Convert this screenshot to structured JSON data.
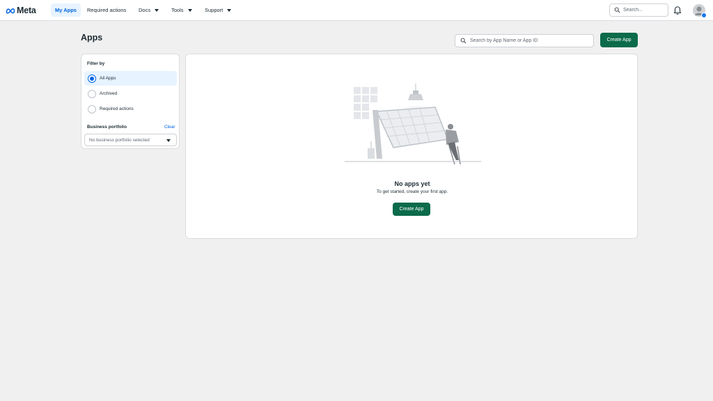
{
  "nav": {
    "brand": "Meta",
    "items": [
      {
        "label": "My Apps"
      },
      {
        "label": "Required actions"
      },
      {
        "label": "Docs"
      },
      {
        "label": "Tools"
      },
      {
        "label": "Support"
      }
    ],
    "search_placeholder": "Search..."
  },
  "header": {
    "title": "Apps",
    "search_placeholder": "Search by App Name or App ID",
    "create_label": "Create App"
  },
  "filter": {
    "title": "Filter by",
    "options": [
      {
        "label": "All Apps",
        "selected": true
      },
      {
        "label": "Archived",
        "selected": false
      },
      {
        "label": "Required actions",
        "selected": false
      }
    ],
    "portfolio_label": "Business portfolio",
    "clear_label": "Clear",
    "portfolio_value": "No business portfolio selected"
  },
  "empty": {
    "title": "No apps yet",
    "subtitle": "To get started, create your first app.",
    "create_label": "Create App"
  },
  "colors": {
    "accent": "#0064e0",
    "primary_button": "#0b6b4a",
    "background": "#f0f0f0"
  }
}
